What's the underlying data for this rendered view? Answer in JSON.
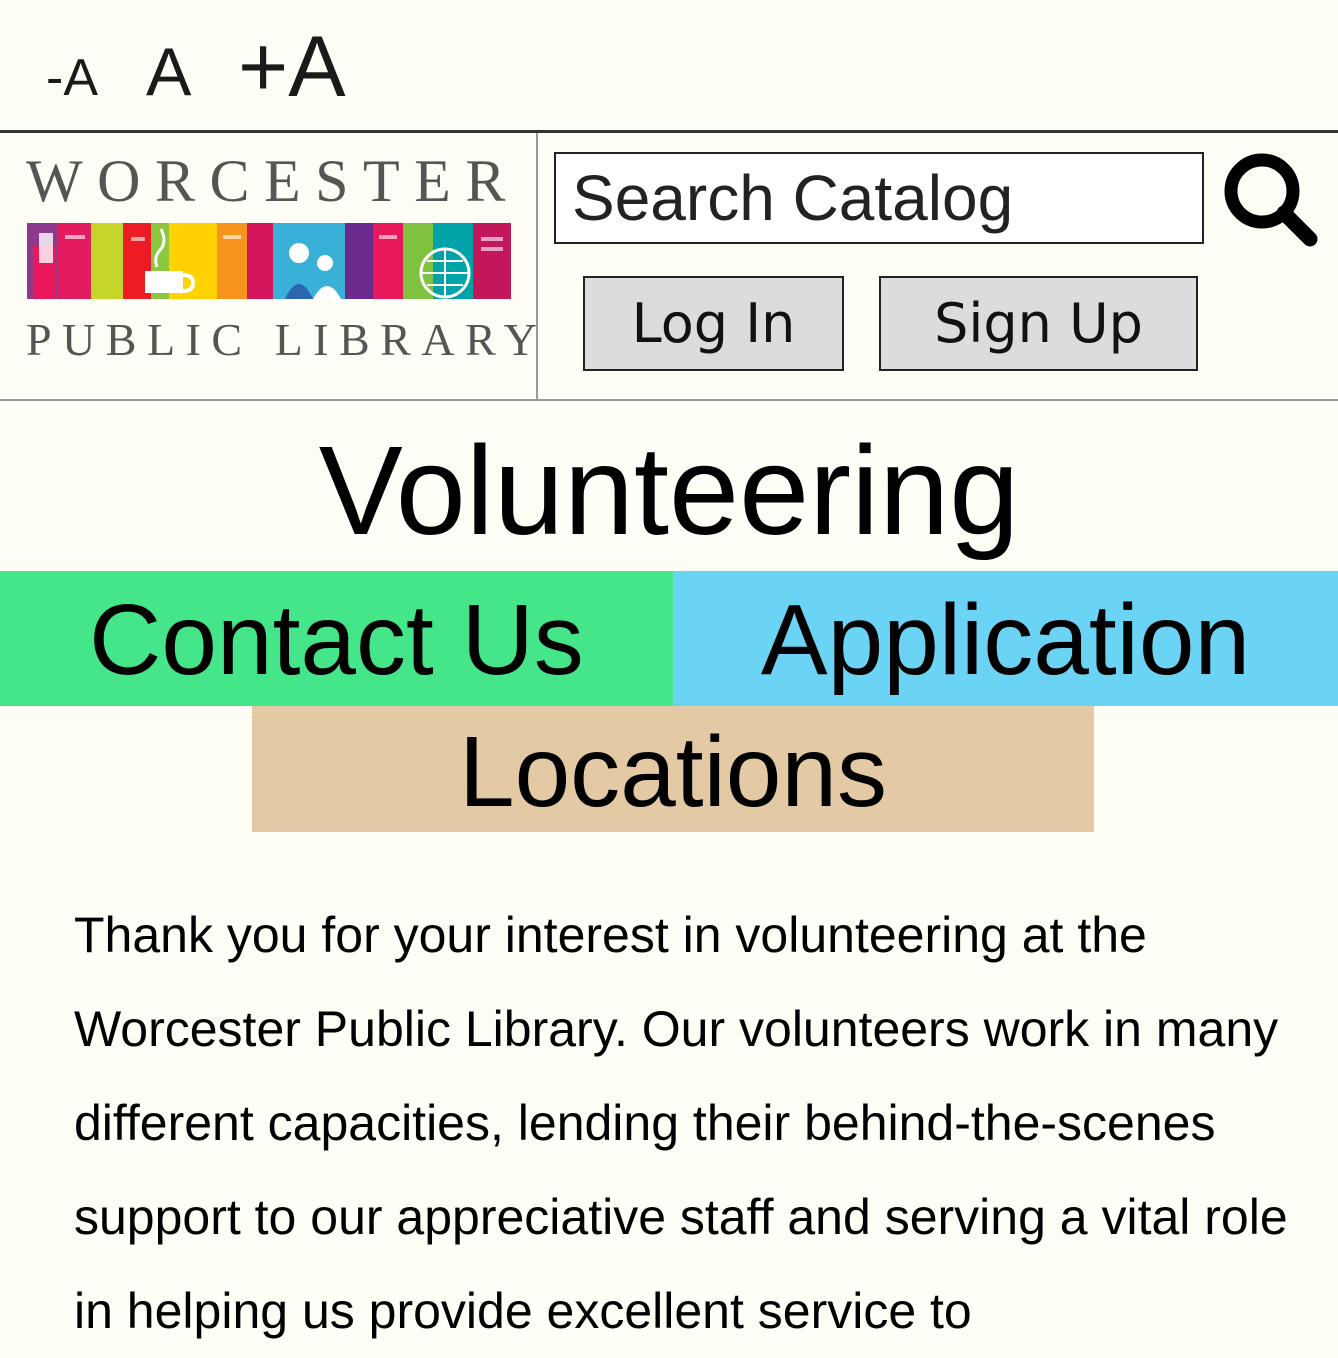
{
  "font_controls": {
    "decrease_label": "-A",
    "normal_label": "A",
    "increase_label": "+A"
  },
  "logo": {
    "top_text": "WORCESTER",
    "bottom_text": "PUBLIC LIBRARY",
    "book_colors": [
      "#8e3a8c",
      "#e8185a",
      "#c6d52a",
      "#ed1c24",
      "#ffd200",
      "#38b0d8",
      "#80c341",
      "#e31b5f",
      "#2b66b0",
      "#6b2b8e",
      "#e8185a",
      "#8dc63f",
      "#00a3a8",
      "#e31b5f"
    ]
  },
  "search": {
    "placeholder": "Search Catalog",
    "icon": "search-icon"
  },
  "auth": {
    "login_label": "Log In",
    "signup_label": "Sign Up"
  },
  "page": {
    "title": "Volunteering"
  },
  "nav": {
    "contact_label": "Contact Us",
    "contact_color": "#44e689",
    "application_label": "Application",
    "application_color": "#6bd3f3",
    "locations_label": "Locations",
    "locations_color": "#e3caa5"
  },
  "content": {
    "intro": "Thank you for your interest in volunteering at the Worcester Public Library. Our volunteers work in many different capacities, lending their behind-the-scenes support to our appreciative staff and serving a vital role in helping us provide excellent service to"
  }
}
